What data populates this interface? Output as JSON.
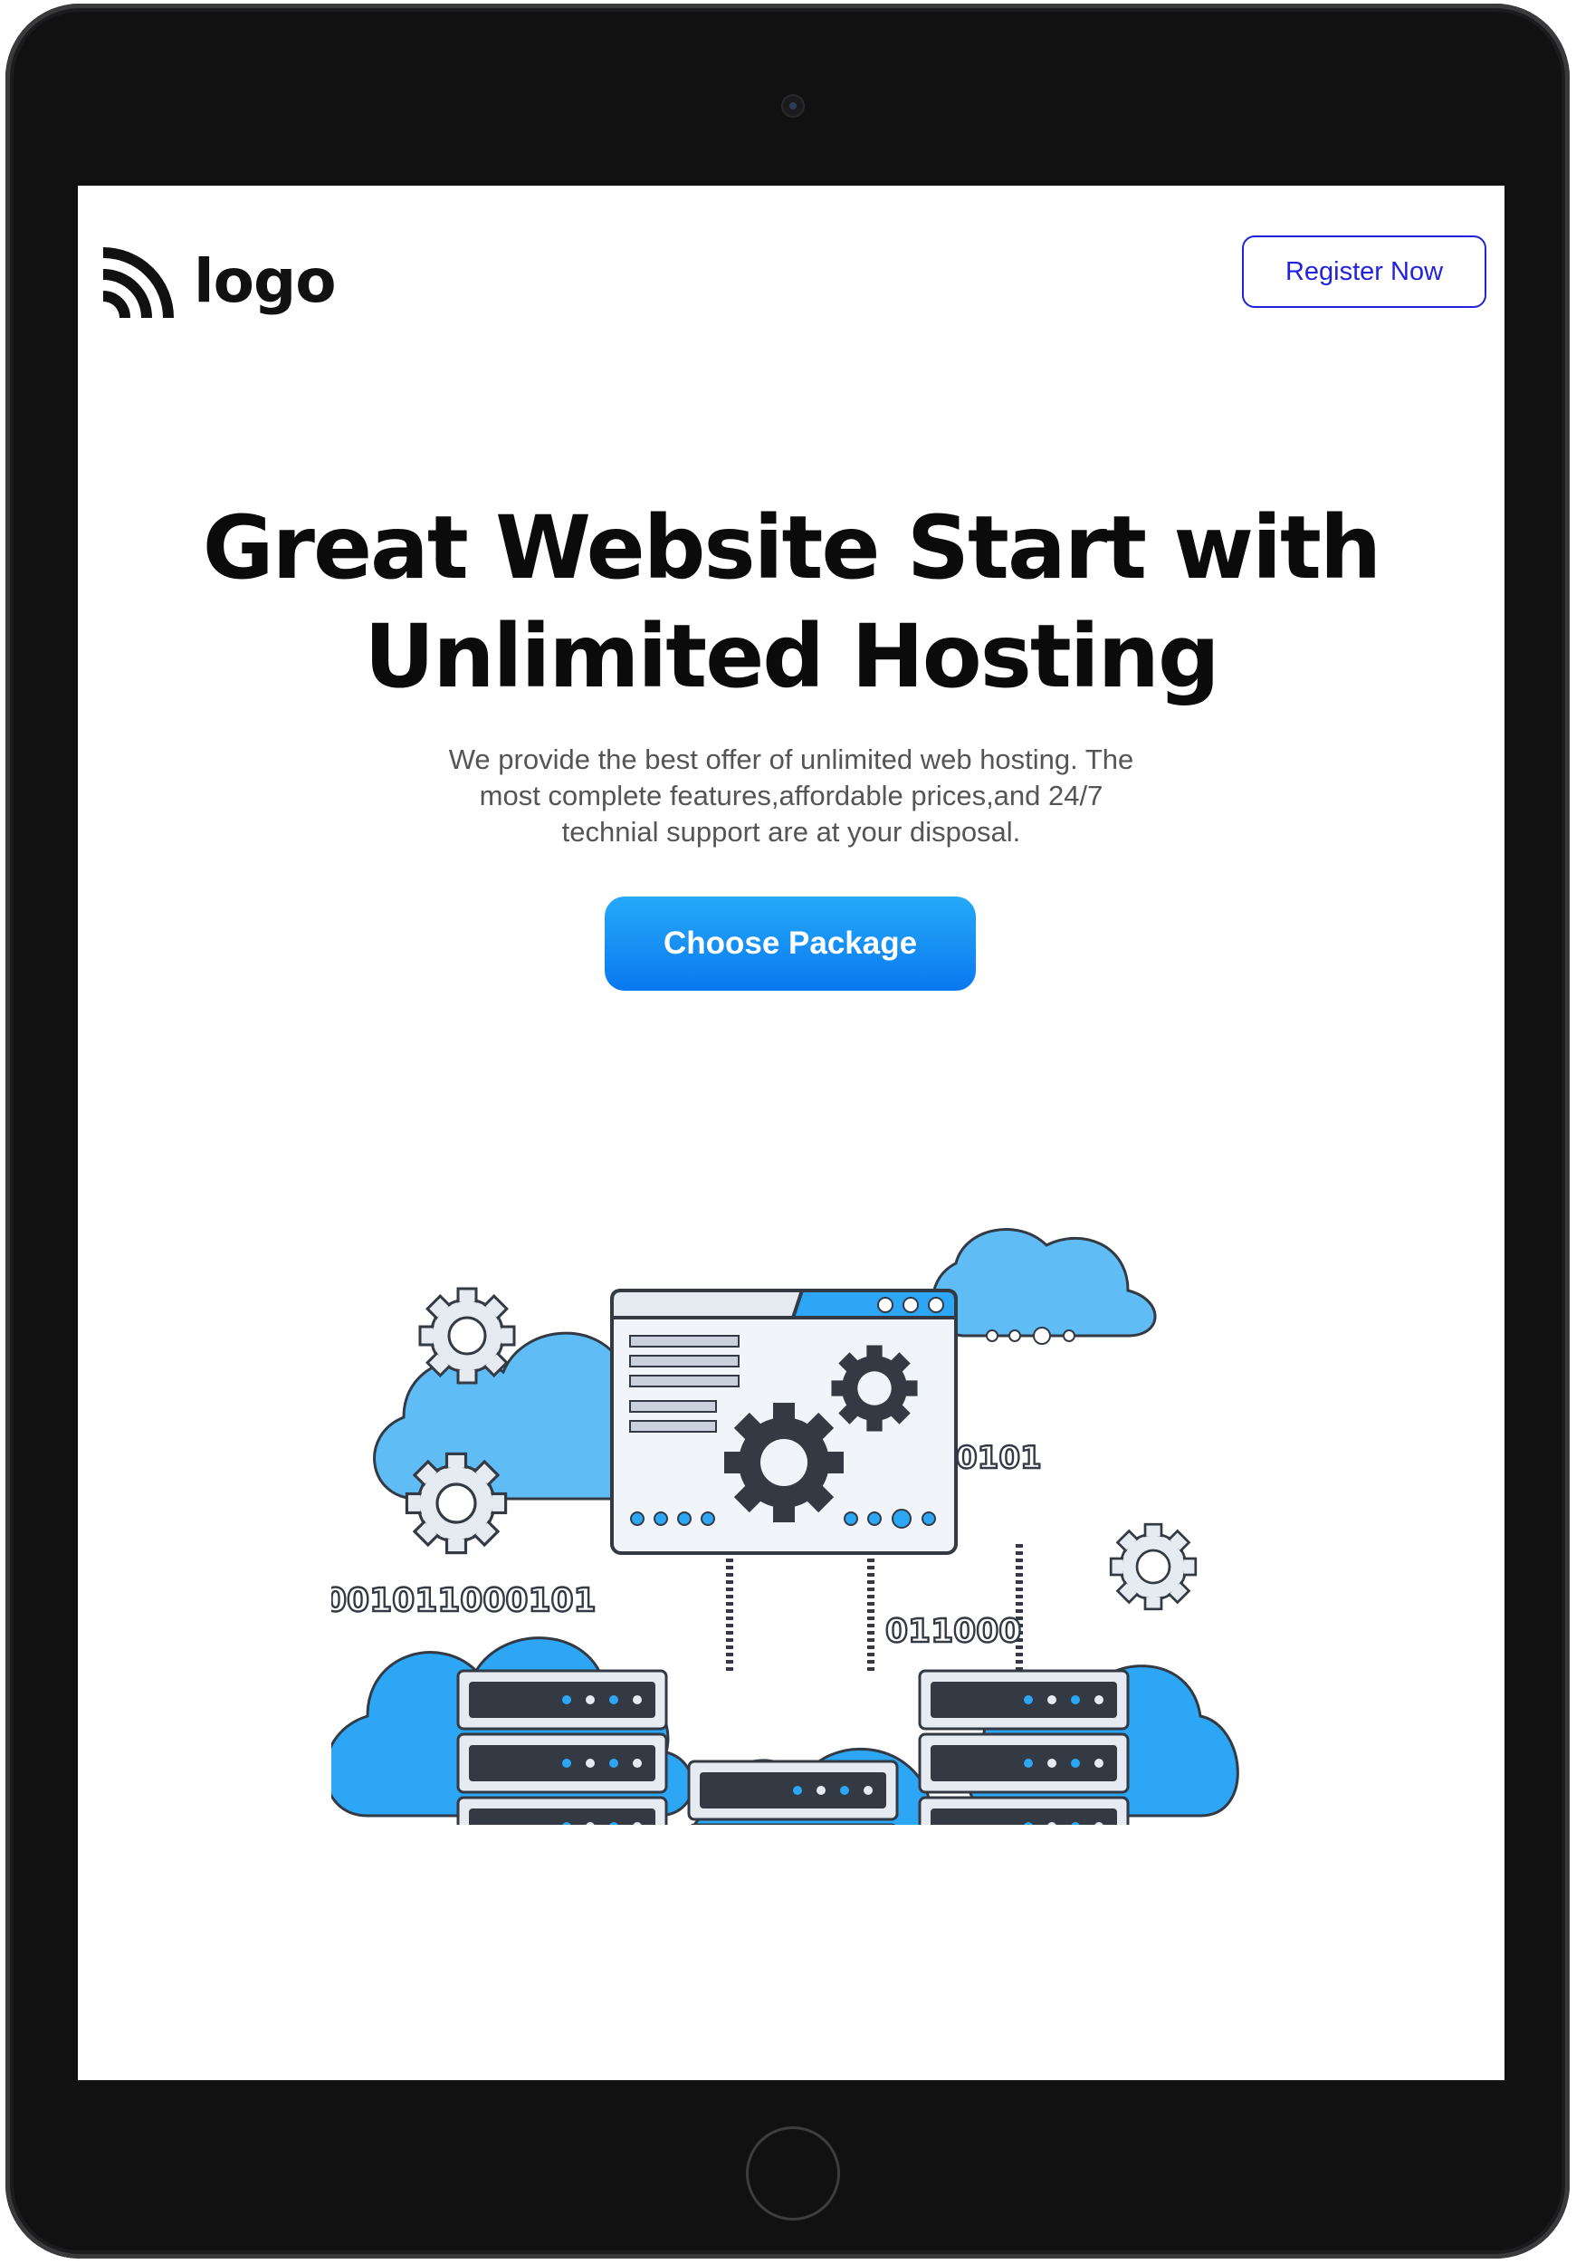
{
  "header": {
    "logo_text": "logo",
    "logo_icon": "wifi-arcs-icon",
    "register_label": "Register Now"
  },
  "hero": {
    "title_line1": "Great Website Start with",
    "title_line2": "Unlimited Hosting",
    "subtitle_line1": "We provide the best offer of unlimited web hosting. The",
    "subtitle_line2": "most complete features,affordable prices,and 24/7",
    "subtitle_line3": "technial support are at your disposal.",
    "cta_label": "Choose Package"
  },
  "illustration": {
    "binary_1": "0101",
    "binary_2": "001011000101",
    "binary_3": "011000",
    "binary_4": "0010101"
  },
  "colors": {
    "accent_blue": "#2222dd",
    "cta_gradient_top": "#25aaf8",
    "cta_gradient_bottom": "#0a78f0",
    "cloud_blue": "#2ca6f5",
    "dark_slate": "#333a44"
  }
}
